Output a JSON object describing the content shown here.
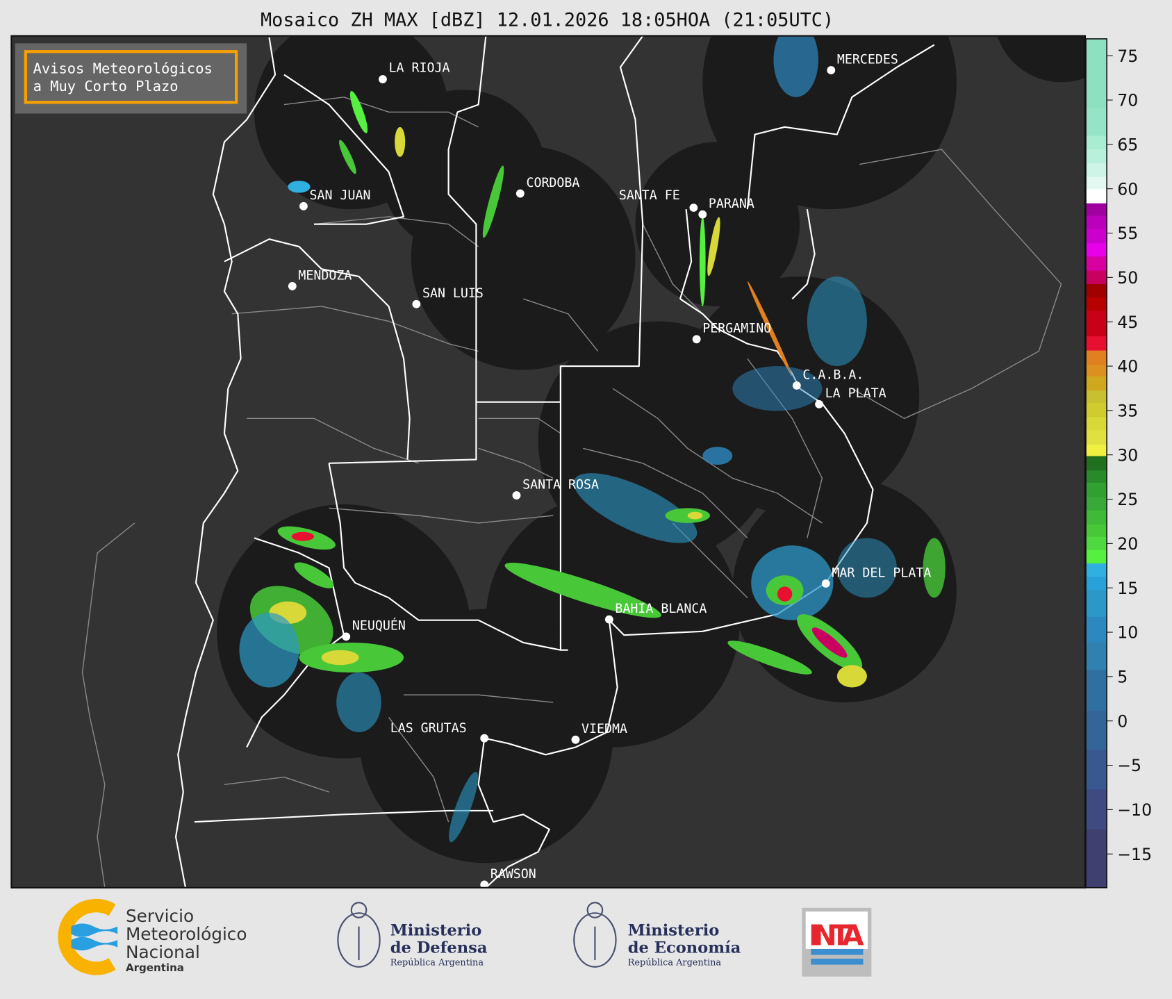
{
  "title": "Mosaico ZH MAX [dBZ] 12.01.2026 18:05HOA (21:05UTC)",
  "notice_box": {
    "line1": "Avisos Meteorológicos",
    "line2": "a Muy Corto Plazo",
    "border_color": "#f5a000"
  },
  "cities": [
    {
      "name": "LA RIOJA"
    },
    {
      "name": "SAN JUAN"
    },
    {
      "name": "CORDOBA"
    },
    {
      "name": "SANTA FE"
    },
    {
      "name": "PARANA"
    },
    {
      "name": "MENDOZA"
    },
    {
      "name": "SAN LUIS"
    },
    {
      "name": "PERGAMINO"
    },
    {
      "name": "MERCEDES"
    },
    {
      "name": "C.A.B.A."
    },
    {
      "name": "LA PLATA"
    },
    {
      "name": "SANTA ROSA"
    },
    {
      "name": "MAR DEL PLATA"
    },
    {
      "name": "BAHIA BLANCA"
    },
    {
      "name": "NEUQUÉN"
    },
    {
      "name": "LAS GRUTAS"
    },
    {
      "name": "VIEDMA"
    },
    {
      "name": "RAWSON"
    }
  ],
  "colorbar": {
    "unit": "dBZ",
    "range": [
      -18.8,
      76.9
    ],
    "ticks": [
      "75",
      "70",
      "65",
      "60",
      "55",
      "50",
      "45",
      "40",
      "35",
      "30",
      "25",
      "20",
      "15",
      "10",
      "5",
      "0",
      "−5",
      "−10",
      "−15"
    ],
    "tick_values": [
      75,
      70,
      65,
      60,
      55,
      50,
      45,
      40,
      35,
      30,
      25,
      20,
      15,
      10,
      5,
      0,
      -5,
      -10,
      -15
    ],
    "levels": [
      {
        "from": -18.8,
        "color": "#404070"
      },
      {
        "from": -12.2,
        "color": "#3e4a80"
      },
      {
        "from": -7.7,
        "color": "#3a5890"
      },
      {
        "from": -3.2,
        "color": "#356598"
      },
      {
        "from": 1.2,
        "color": "#3070a0"
      },
      {
        "from": 5.8,
        "color": "#3080b0"
      },
      {
        "from": 8.9,
        "color": "#2e88c0"
      },
      {
        "from": 11.8,
        "color": "#2c98c8"
      },
      {
        "from": 14.8,
        "color": "#28a0d8"
      },
      {
        "from": 16.3,
        "color": "#30b0e0"
      },
      {
        "from": 17.8,
        "color": "#55f040"
      },
      {
        "from": 19.3,
        "color": "#50d840"
      },
      {
        "from": 20.8,
        "color": "#48c838"
      },
      {
        "from": 22.2,
        "color": "#40b838"
      },
      {
        "from": 23.8,
        "color": "#38a838"
      },
      {
        "from": 25.3,
        "color": "#30a030"
      },
      {
        "from": 26.9,
        "color": "#288a28"
      },
      {
        "from": 28.3,
        "color": "#207020"
      },
      {
        "from": 29.9,
        "color": "#f0f040"
      },
      {
        "from": 31.2,
        "color": "#e0e040"
      },
      {
        "from": 32.8,
        "color": "#d8d838"
      },
      {
        "from": 34.3,
        "color": "#d0cc30"
      },
      {
        "from": 35.9,
        "color": "#c8c030"
      },
      {
        "from": 37.3,
        "color": "#d0a820"
      },
      {
        "from": 38.9,
        "color": "#dc9020"
      },
      {
        "from": 40.2,
        "color": "#e08020"
      },
      {
        "from": 41.8,
        "color": "#e81030"
      },
      {
        "from": 43.4,
        "color": "#c80018"
      },
      {
        "from": 46.3,
        "color": "#b80000"
      },
      {
        "from": 47.8,
        "color": "#a00000"
      },
      {
        "from": 49.3,
        "color": "#c80060"
      },
      {
        "from": 50.8,
        "color": "#d800a0"
      },
      {
        "from": 52.4,
        "color": "#e800e8"
      },
      {
        "from": 53.9,
        "color": "#cc00cc"
      },
      {
        "from": 55.5,
        "color": "#bb00bb"
      },
      {
        "from": 57.0,
        "color": "#a000a0"
      },
      {
        "from": 58.4,
        "color": "#ffffff"
      },
      {
        "from": 60.0,
        "color": "#e2f8f0"
      },
      {
        "from": 61.4,
        "color": "#cdf4e6"
      },
      {
        "from": 62.9,
        "color": "#b8f0dc"
      },
      {
        "from": 64.5,
        "color": "#a8ecd2"
      },
      {
        "from": 66.0,
        "color": "#96e4c8"
      },
      {
        "from": 69.1,
        "color": "#8de0c0"
      }
    ]
  },
  "footer": {
    "smn": {
      "line1": "Servicio",
      "line2": "Meteorológico",
      "line3": "Nacional",
      "line4": "Argentina"
    },
    "defensa": {
      "line1": "Ministerio",
      "line2": "de Defensa",
      "line3": "República Argentina"
    },
    "economia": {
      "line1": "Ministerio",
      "line2": "de Economía",
      "line3": "República Argentina"
    },
    "inta": {
      "label": "INTA"
    }
  }
}
